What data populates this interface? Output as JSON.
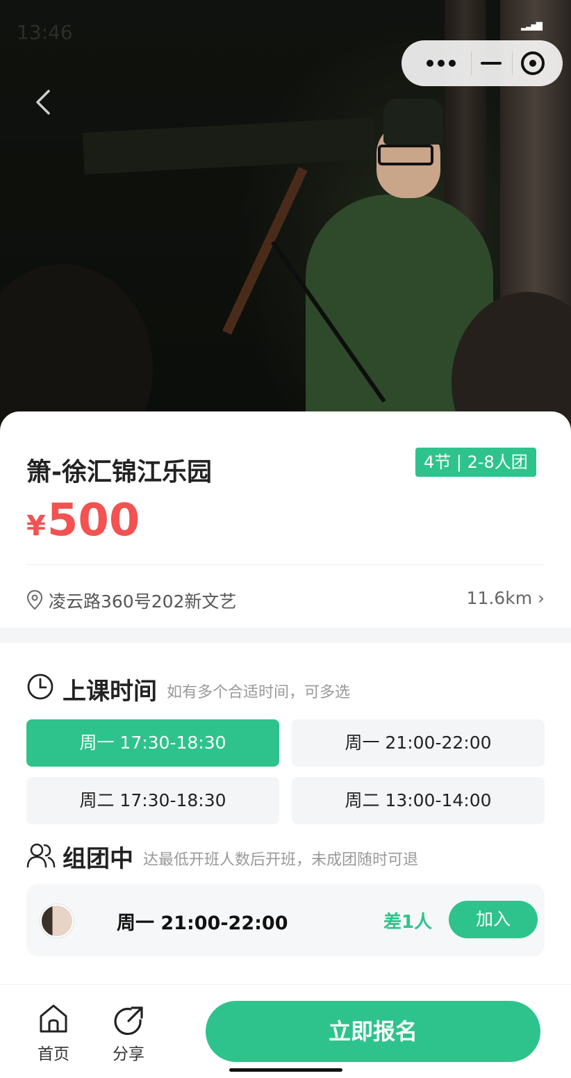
{
  "status": {
    "time": "13:46"
  },
  "course": {
    "title": "箫-徐汇锦江乐园",
    "tag": "4节 | 2-8人团",
    "price_currency": "¥",
    "price": "500",
    "address": "凌云路360号202新文艺",
    "distance": "11.6km ›"
  },
  "schedule": {
    "title": "上课时间",
    "hint": "如有多个合适时间，可多选",
    "slots": [
      {
        "label": "周一 17:30-18:30",
        "selected": true
      },
      {
        "label": "周一 21:00-22:00",
        "selected": false
      },
      {
        "label": "周二 17:30-18:30",
        "selected": false
      },
      {
        "label": "周二 13:00-14:00",
        "selected": false
      }
    ]
  },
  "group": {
    "title": "组团中",
    "hint": "达最低开班人数后开班，未成团随时可退",
    "item": {
      "time": "周一 21:00-22:00",
      "lack": "差1人",
      "join_label": "加入"
    }
  },
  "tabbar": {
    "home_label": "首页",
    "share_label": "分享",
    "cta_label": "立即报名"
  },
  "colors": {
    "accent": "#2ec38c",
    "price": "#f25252"
  },
  "icons": [
    "back-arrow-icon",
    "more-dots-icon",
    "minimize-icon",
    "target-icon",
    "location-pin-icon",
    "clock-icon",
    "people-icon",
    "home-icon",
    "share-icon"
  ]
}
